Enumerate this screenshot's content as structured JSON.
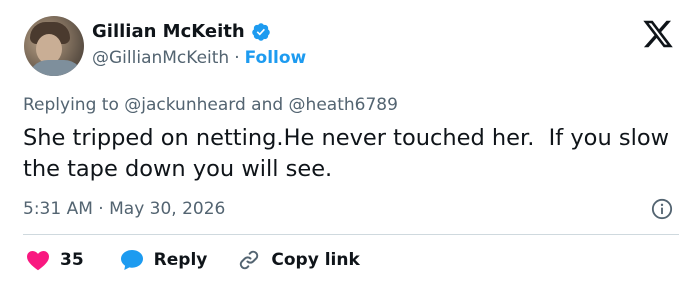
{
  "author": {
    "display_name": "Gillian McKeith",
    "handle": "@GillianMcKeith",
    "separator": "·",
    "follow_label": "Follow",
    "verified": true
  },
  "tweet": {
    "replying_prefix": "Replying to",
    "replying_to_1": "@jackunheard",
    "replying_and": "and",
    "replying_to_2": "@heath6789",
    "text": "She tripped on netting.He never touched her.  If you slow the tape down you will see.",
    "time": "5:31 AM",
    "date_separator": "·",
    "date": "May 30, 2026"
  },
  "actions": {
    "like_count": "35",
    "reply_label": "Reply",
    "copy_link_label": "Copy link"
  },
  "colors": {
    "accent": "#1d9bf0",
    "like": "#f91880",
    "text": "#0f1419",
    "muted": "#536471"
  },
  "icons": [
    "avatar-image",
    "verified-badge-icon",
    "x-logo-icon",
    "info-icon",
    "heart-icon",
    "reply-bubble-icon",
    "link-icon"
  ]
}
